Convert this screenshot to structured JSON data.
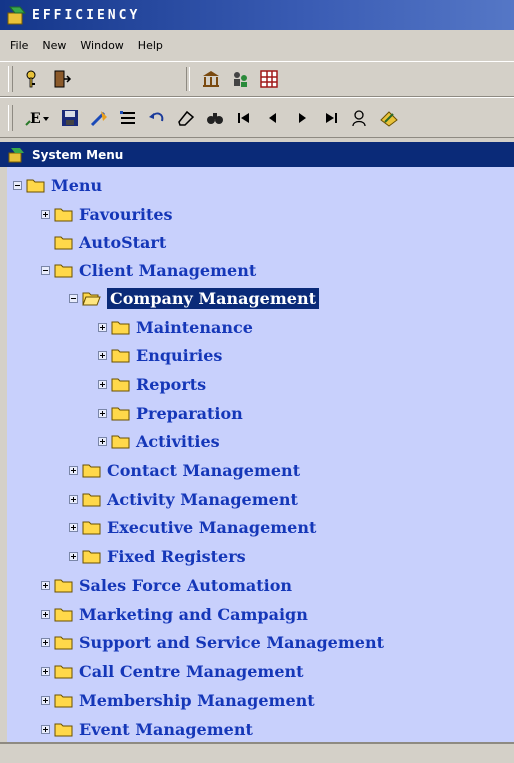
{
  "app": {
    "title": "EFFICIENCY"
  },
  "menubar": {
    "items": [
      "File",
      "New",
      "Window",
      "Help"
    ]
  },
  "toolbar1": {
    "buttons": [
      "key-icon",
      "door-exit-icon",
      "building-icon",
      "users-icon",
      "grid-icon"
    ]
  },
  "toolbar2": {
    "buttons": [
      "edit-dropdown-icon",
      "save-icon",
      "clear-icon",
      "list-icon",
      "undo-icon",
      "eraser-icon",
      "find-icon",
      "first-record-icon",
      "previous-record-icon",
      "next-record-icon",
      "last-record-icon",
      "user-search-icon",
      "note-icon"
    ]
  },
  "panel": {
    "title": "System Menu"
  },
  "tree": {
    "root": "Menu",
    "favourites": "Favourites",
    "autostart": "AutoStart",
    "client_management": "Client Management",
    "company_management": "Company Management",
    "maintenance": "Maintenance",
    "enquiries": "Enquiries",
    "reports": "Reports",
    "preparation": "Preparation",
    "activities": "Activities",
    "contact_management": "Contact Management",
    "activity_management": "Activity Management",
    "executive_management": "Executive Management",
    "fixed_registers": "Fixed Registers",
    "sales_force_automation": "Sales Force Automation",
    "marketing_and_campaign": "Marketing and Campaign",
    "support_and_service_management": "Support and Service Management",
    "call_centre_management": "Call Centre Management",
    "membership_management": "Membership Management",
    "event_management": "Event Management"
  },
  "colors": {
    "tree_bg": "#c8d0fc",
    "label_text": "#1537b8",
    "selection_bg": "#0a2a78",
    "folder": "#ffd84a"
  }
}
